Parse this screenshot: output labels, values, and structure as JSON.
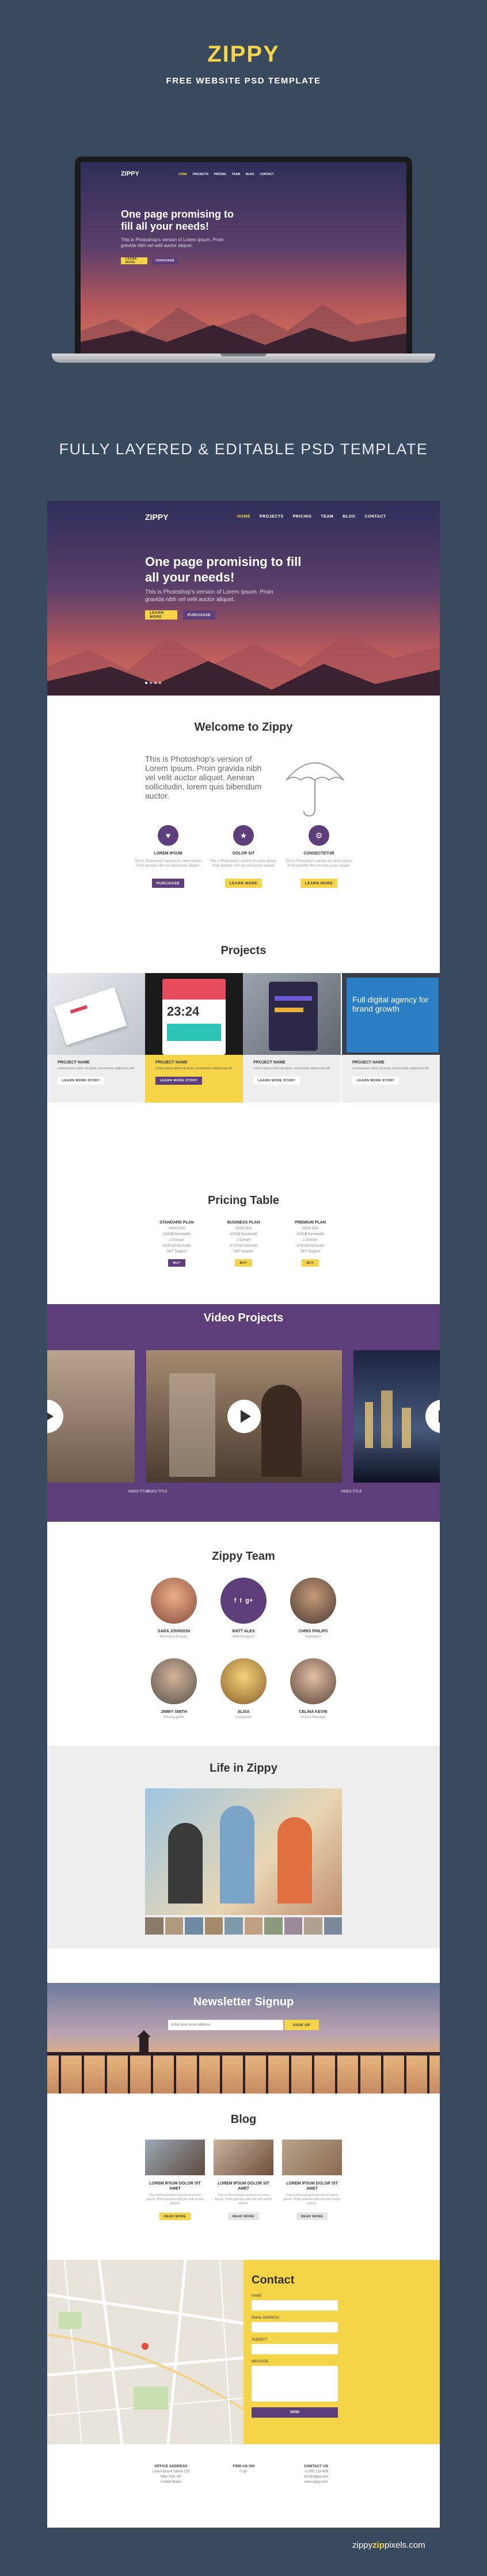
{
  "header": {
    "brand": "ZIPPY",
    "subtitle": "FREE WEBSITE PSD TEMPLATE",
    "tagline": "FULLY LAYERED & EDITABLE PSD TEMPLATE"
  },
  "nav": {
    "logo": "ZIPPY",
    "items": [
      {
        "label": "HOME"
      },
      {
        "label": "PROJECTS"
      },
      {
        "label": "PRICING"
      },
      {
        "label": "TEAM"
      },
      {
        "label": "BLOG"
      },
      {
        "label": "CONTACT"
      }
    ]
  },
  "hero": {
    "headline": "One page promising to fill all your needs!",
    "text": "This is Photoshop's version of Lorem Ipsum. Proin gravida nibh vel velit auctor aliquet.",
    "btn_primary": "LEARN MORE",
    "btn_secondary": "PURCHASE"
  },
  "welcome": {
    "title": "Welcome to Zippy",
    "text": "This is Photoshop's version of Lorem Ipsum. Proin gravida nibh vel velit auctor aliquet. Aenean sollicitudin, lorem quis bibendum auctor.",
    "features": [
      {
        "title": "LOREM IPSUM",
        "desc": "This is Photoshop's version of Lorem Ipsum. Proin gravida nibh vel velit auctor aliquet.",
        "button": "PURCHASE"
      },
      {
        "title": "DOLOR SIT",
        "desc": "This is Photoshop's version of Lorem Ipsum. Proin gravida nibh vel velit auctor aliquet.",
        "button": "LEARN MORE"
      },
      {
        "title": "CONSECTETUR",
        "desc": "This is Photoshop's version of Lorem Ipsum. Proin gravida nibh vel velit auctor aliquet.",
        "button": "LEARN MORE"
      }
    ]
  },
  "projects": {
    "title": "Projects",
    "screen_time": "23:24",
    "screen_headline": "Full digital agency for brand growth",
    "items": [
      {
        "name": "PROJECT NAME",
        "desc": "Lorem ipsum dolor sit amet, consectetur adipiscing elit.",
        "button": "LEARN MORE STORY"
      },
      {
        "name": "PROJECT NAME",
        "desc": "Lorem ipsum dolor sit amet, consectetur adipiscing elit.",
        "button": "LEARN MORE STORY"
      },
      {
        "name": "PROJECT NAME",
        "desc": "Lorem ipsum dolor sit amet, consectetur adipiscing elit.",
        "button": "LEARN MORE STORY"
      },
      {
        "name": "PROJECT NAME",
        "desc": "Lorem ipsum dolor sit amet, consectetur adipiscing elit.",
        "button": "LEARN MORE STORY"
      }
    ]
  },
  "pricing": {
    "title": "Pricing Table",
    "plans": [
      {
        "name": "STANDARD PLAN",
        "lines": [
          "10GB Disk",
          "100GB Bandwidth",
          "1 Domain",
          "10 Email Accounts",
          "24/7 Support"
        ],
        "button": "BUY"
      },
      {
        "name": "BUSINESS PLAN",
        "lines": [
          "10GB Disk",
          "100GB Bandwidth",
          "1 Domain",
          "10 Email Accounts",
          "24/7 Support"
        ],
        "button": "BUY"
      },
      {
        "name": "PREMIUM PLAN",
        "lines": [
          "10GB Disk",
          "100GB Bandwidth",
          "1 Domain",
          "10 Email Accounts",
          "24/7 Support"
        ],
        "button": "BUY"
      }
    ]
  },
  "video": {
    "title": "Video Projects",
    "captions": [
      "VIDEO TITLE",
      "VIDEO TITLE",
      "VIDEO TITLE"
    ]
  },
  "team": {
    "title": "Zippy Team",
    "members": [
      {
        "name": "SARA JOHNSON",
        "role": "Marketing Director"
      },
      {
        "name": "MATT ALEX",
        "role": "Web Designer"
      },
      {
        "name": "CHRIS PHILIPS",
        "role": "Developer"
      },
      {
        "name": "JIMMY SMITH",
        "role": "Photographer"
      },
      {
        "name": "ALISA",
        "role": "Copywriter"
      },
      {
        "name": "CELINA KEVIN",
        "role": "Project Manager"
      }
    ]
  },
  "life": {
    "title": "Life in Zippy"
  },
  "newsletter": {
    "title": "Newsletter Signup",
    "placeholder": "Enter your email address",
    "button": "SIGN UP"
  },
  "blog": {
    "title": "Blog",
    "posts": [
      {
        "title": "LOREM IPSUM DOLOR SIT AMET",
        "desc": "This is Photoshop's version of Lorem Ipsum. Proin gravida nibh vel velit auctor aliquet.",
        "button": "READ MORE"
      },
      {
        "title": "LOREM IPSUM DOLOR SIT AMET",
        "desc": "This is Photoshop's version of Lorem Ipsum. Proin gravida nibh vel velit auctor aliquet.",
        "button": "READ MORE"
      },
      {
        "title": "LOREM IPSUM DOLOR SIT AMET",
        "desc": "This is Photoshop's version of Lorem Ipsum. Proin gravida nibh vel velit auctor aliquet.",
        "button": "READ MORE"
      }
    ]
  },
  "contact": {
    "title": "Contact",
    "name_label": "NAME",
    "email_label": "EMAIL ADDRESS",
    "subject_label": "SUBJECT",
    "message_label": "MESSAGE",
    "button": "SEND"
  },
  "footer": {
    "columns": [
      {
        "heading": "OFFICE ADDRESS",
        "lines": [
          "Lorem Ipsum Street 123",
          "New York, NY",
          "United States"
        ]
      },
      {
        "heading": "FIND US ON",
        "lines": [
          "f   t   g+"
        ]
      },
      {
        "heading": "CONTACT US",
        "lines": [
          "+1 800 123 456",
          "info@zippy.com",
          "www.zippy.com"
        ]
      }
    ]
  },
  "credit": {
    "prefix": "zippy",
    "highlight": "zip",
    "suffix": "pixels.com"
  },
  "colors": {
    "brand_yellow": "#f5d547",
    "brand_purple": "#5d3e7a",
    "background": "#3a4a5e"
  }
}
